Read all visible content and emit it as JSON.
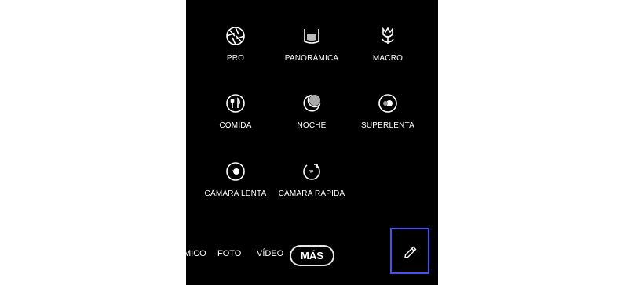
{
  "modes": [
    {
      "label": "PRO",
      "icon": "aperture-icon"
    },
    {
      "label": "PANORÁMICA",
      "icon": "panorama-icon"
    },
    {
      "label": "MACRO",
      "icon": "flower-icon"
    },
    {
      "label": "COMIDA",
      "icon": "fork-knife-icon"
    },
    {
      "label": "NOCHE",
      "icon": "moon-icon"
    },
    {
      "label": "SUPERLENTA",
      "icon": "super-slow-icon"
    },
    {
      "label": "CÁMARA LENTA",
      "icon": "slow-motion-icon"
    },
    {
      "label": "CÁMARA RÁPIDA",
      "icon": "hyperlapse-icon"
    }
  ],
  "tabs": [
    {
      "label": "MICO"
    },
    {
      "label": "FOTO"
    },
    {
      "label": "VÍDEO"
    },
    {
      "label": "MÁS",
      "active": true
    }
  ],
  "colors": {
    "background": "#000000",
    "text": "#ffffff",
    "highlight": "#4a4ff0"
  },
  "edit_icon": "pencil-icon"
}
